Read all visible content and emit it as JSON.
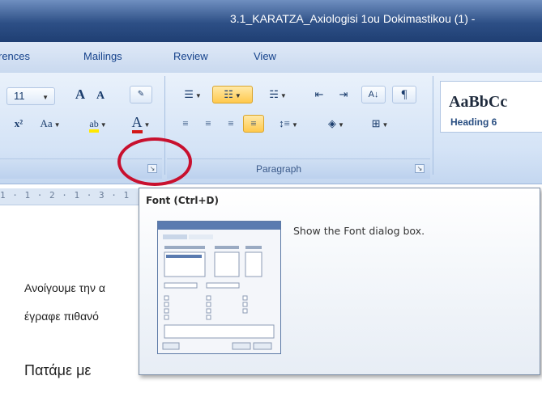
{
  "window": {
    "title": "3.1_KARATZA_Axiologisi 1ou Dokimastikou (1) -"
  },
  "tabs": [
    {
      "label": "rences"
    },
    {
      "label": "Mailings"
    },
    {
      "label": "Review"
    },
    {
      "label": "View"
    }
  ],
  "font_group": {
    "font_size": "11",
    "grow_font": "A",
    "shrink_font": "A",
    "superscript": "x²",
    "change_case": "Aa",
    "highlight": "ab",
    "font_color": "A"
  },
  "paragraph_group": {
    "label": "Paragraph",
    "sort": "A↓",
    "pilcrow": "¶"
  },
  "styles": {
    "preview": "AaBbCc",
    "name": "Heading 6"
  },
  "ruler": {
    "text": "1 · 1 · 2 · 1 · 3 · 1"
  },
  "document": {
    "line1": "Ανοίγουμε την α",
    "line2": "έγραφε πιθανό",
    "line3": "Πατάμε  με"
  },
  "tooltip": {
    "title": "Font (Ctrl+D)",
    "description": "Show the Font dialog box."
  },
  "colors": {
    "highlight_circle": "#c8102e",
    "highlight_yellow": "#ffe800",
    "font_red": "#d21818"
  }
}
